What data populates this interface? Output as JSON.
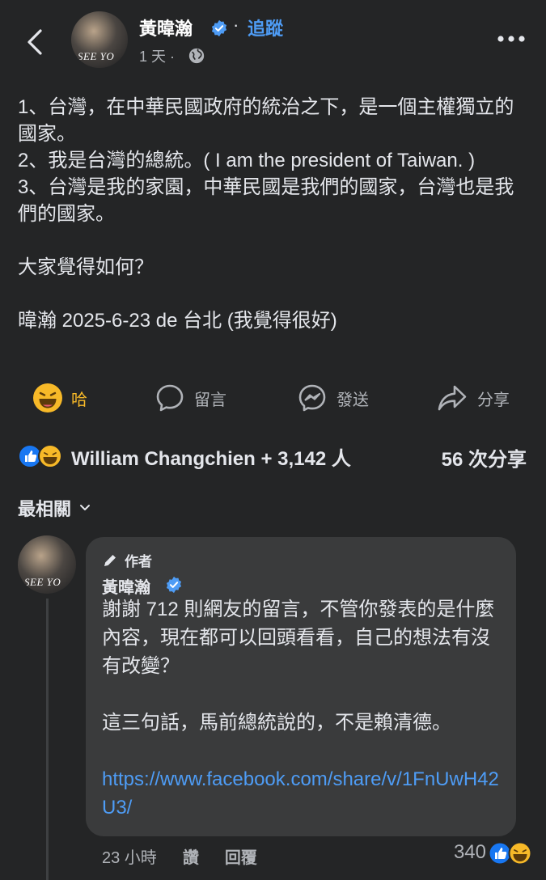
{
  "header": {
    "author": "黃暐瀚",
    "follow_dot": "·",
    "follow_label": "追蹤",
    "time": "1 天 ·",
    "avatar_caption": "SEE YO"
  },
  "post": {
    "lines": [
      "1、台灣，在中華民國政府的統治之下，是一個主權獨立的國家。",
      "2、我是台灣的總統。( I am the president of Taiwan. )",
      "3、台灣是我的家園，中華民國是我們的國家，台灣也是我們的國家。",
      "",
      "大家覺得如何？",
      "",
      "暐瀚 2025-6-23 de 台北 (我覺得很好)"
    ]
  },
  "actions": {
    "react_label": "哈",
    "comment_label": "留言",
    "send_label": "發送",
    "share_label": "分享"
  },
  "summary": {
    "reactors": "William Changchien + 3,142 人",
    "shares": "56 次分享"
  },
  "sort": {
    "label": "最相關"
  },
  "comment": {
    "badge": "作者",
    "author": "黃暐瀚",
    "avatar_caption": "SEE YO",
    "paragraphs": [
      "謝謝 712 則網友的留言，不管你發表的是什麼內容，現在都可以回頭看看，自己的想法有沒有改變？",
      "這三句話，馬前總統說的，不是賴清德。"
    ],
    "link": "https://www.facebook.com/share/v/1FnUwH42U3/",
    "time": "23 小時",
    "like": "讚",
    "reply": "回覆",
    "reaction_count": "340"
  },
  "colors": {
    "background": "#242526",
    "accent_blue": "#4e9cf5",
    "haha_yellow": "#f7b928",
    "bubble": "#3a3b3c"
  },
  "icons": [
    "back-arrow-icon",
    "verified-icon",
    "globe-icon",
    "more-icon",
    "haha-icon",
    "comment-icon",
    "messenger-icon",
    "share-icon",
    "like-icon",
    "chevron-down-icon",
    "pencil-icon"
  ]
}
